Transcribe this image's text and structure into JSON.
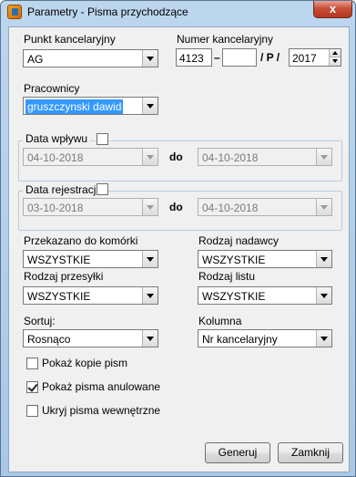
{
  "window": {
    "title": "Parametry - Pisma przychodzące",
    "close_glyph": "x"
  },
  "kancelaryjny": {
    "punkt_label": "Punkt kancelaryjny",
    "punkt_value": "AG",
    "numer_label": "Numer kancelaryjny",
    "numer_value": "4123",
    "dash": "–",
    "numer2_value": "",
    "separator": "/ P /",
    "year_value": "2017"
  },
  "pracownicy": {
    "label": "Pracownicy",
    "value": "gruszczynski dawid"
  },
  "data_wplywu": {
    "label": "Data wpływu",
    "from": "04-10-2018",
    "do_label": "do",
    "to": "04-10-2018",
    "checked": false
  },
  "data_rejestracji": {
    "label": "Data rejestracji",
    "from": "03-10-2018",
    "do_label": "do",
    "to": "04-10-2018",
    "checked": false
  },
  "filters": {
    "przekazano_label": "Przekazano do komórki",
    "przekazano_value": "WSZYSTKIE",
    "rodzaj_nadawcy_label": "Rodzaj nadawcy",
    "rodzaj_nadawcy_value": "WSZYSTKIE",
    "rodzaj_przesylki_label": "Rodzaj przesyłki",
    "rodzaj_przesylki_value": "WSZYSTKIE",
    "rodzaj_listu_label": "Rodzaj listu",
    "rodzaj_listu_value": "WSZYSTKIE"
  },
  "sort": {
    "sortuj_label": "Sortuj:",
    "sortuj_value": "Rosnąco",
    "kolumna_label": "Kolumna",
    "kolumna_value": "Nr kancelaryjny"
  },
  "options": [
    {
      "label": "Pokaż kopie pism",
      "checked": false
    },
    {
      "label": "Pokaż pisma anulowane",
      "checked": true
    },
    {
      "label": "Ukryj pisma wewnętrzne",
      "checked": false
    }
  ],
  "buttons": {
    "generuj": "Generuj",
    "zamknij": "Zamknij"
  },
  "colors": {
    "title_bar": "#a9c8e6",
    "close_button": "#c9503a",
    "selection": "#3399ff",
    "client_bg": "#f0f0f0"
  }
}
